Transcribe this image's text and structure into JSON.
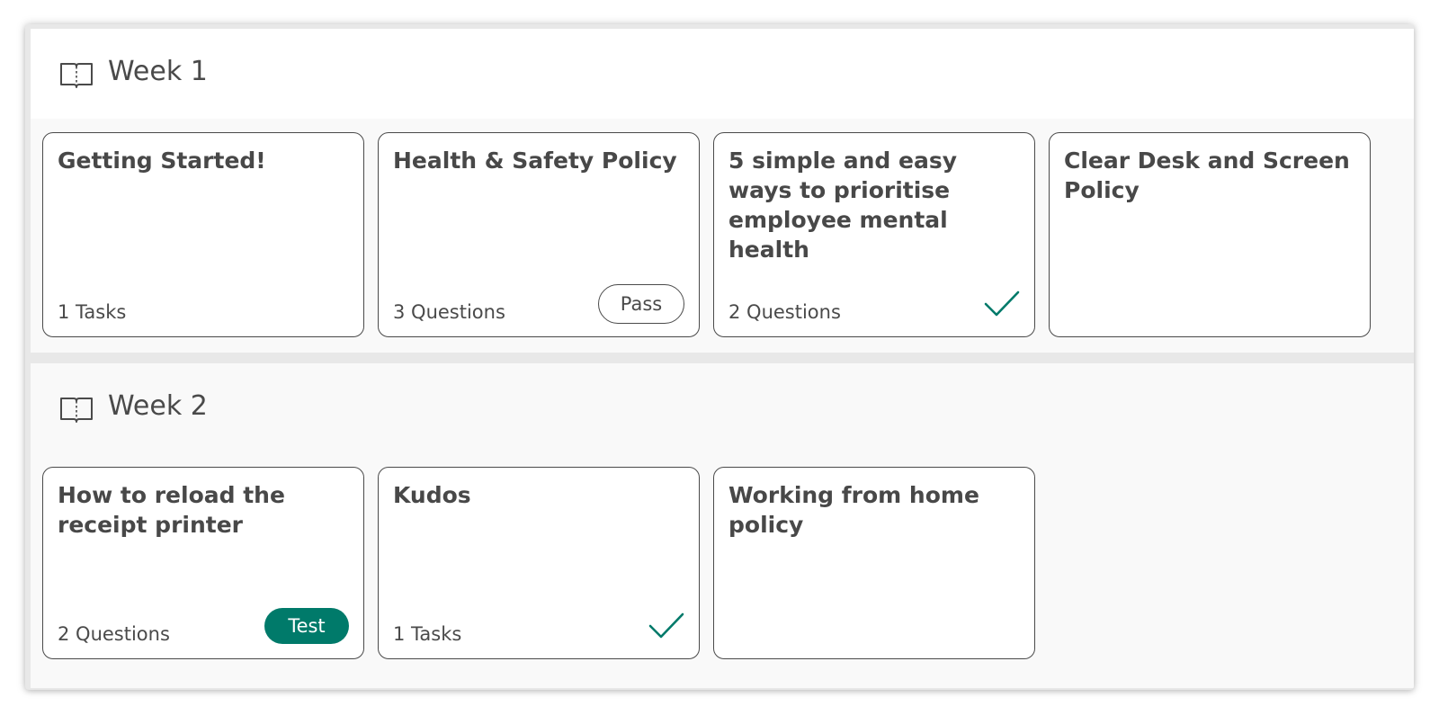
{
  "colors": {
    "accent": "#007a6a",
    "text": "#4a4a4a",
    "border": "#4a4a4a"
  },
  "weeks": [
    {
      "title": "Week 1",
      "icon": "book-icon",
      "cards": [
        {
          "title": "Getting Started!",
          "meta": "1 Tasks",
          "status": "none"
        },
        {
          "title": "Health & Safety Policy",
          "meta": "3 Questions",
          "status": "pass",
          "badge": "Pass"
        },
        {
          "title": "5 simple and easy ways to prioritise employee mental health",
          "meta": "2 Questions",
          "status": "complete",
          "icon": "checkmark-icon"
        },
        {
          "title": "Clear Desk and Screen Policy",
          "meta": "",
          "status": "none"
        }
      ]
    },
    {
      "title": "Week 2",
      "icon": "book-icon",
      "cards": [
        {
          "title": "How to reload the receipt printer",
          "meta": "2 Questions",
          "status": "test",
          "badge": "Test"
        },
        {
          "title": "Kudos",
          "meta": "1 Tasks",
          "status": "complete",
          "icon": "checkmark-icon"
        },
        {
          "title": "Working from home policy",
          "meta": "",
          "status": "none"
        }
      ]
    }
  ]
}
